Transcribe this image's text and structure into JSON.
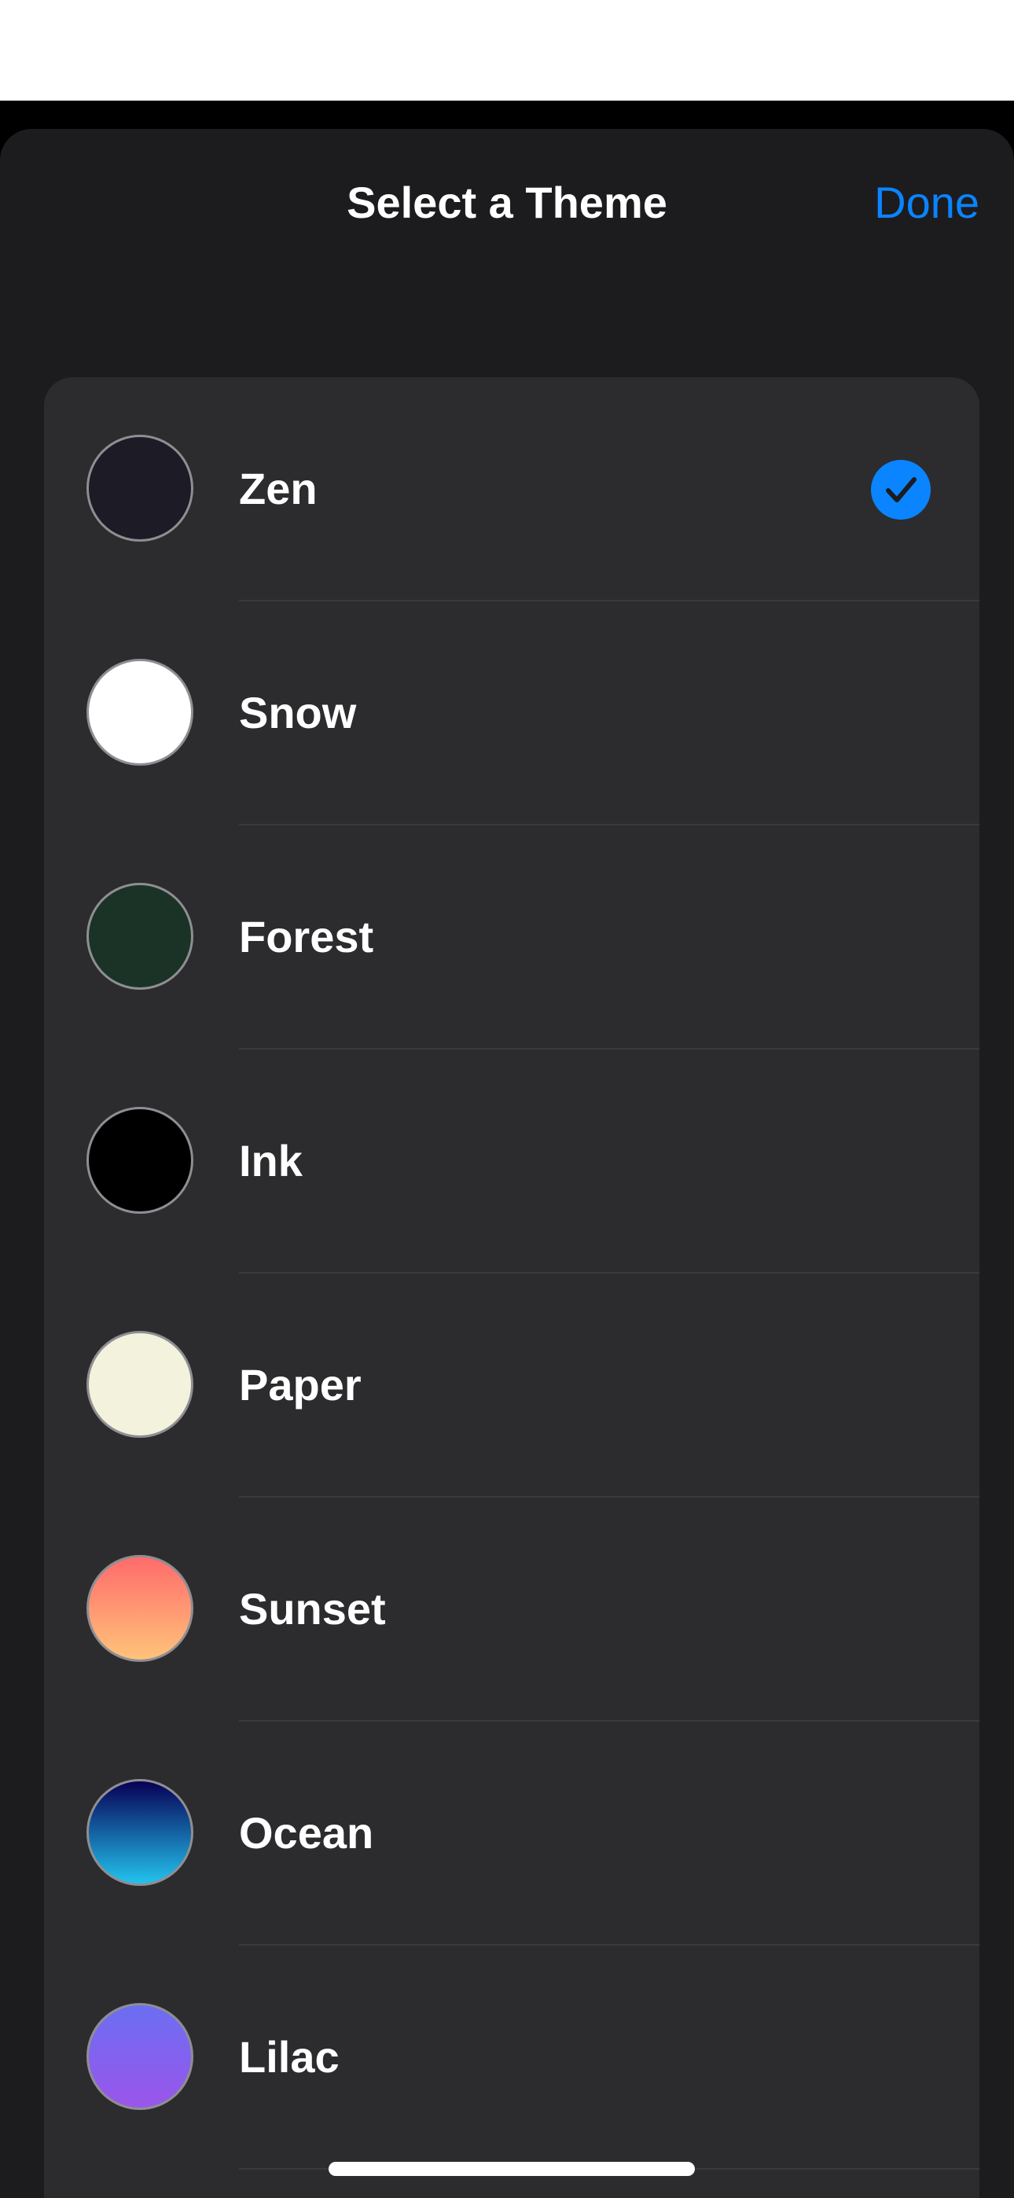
{
  "sheet": {
    "title": "Select a Theme",
    "done_label": "Done"
  },
  "themes": [
    {
      "label": "Zen",
      "swatch": "#1c1b26",
      "selected": true
    },
    {
      "label": "Snow",
      "swatch": "#ffffff",
      "selected": false
    },
    {
      "label": "Forest",
      "swatch": "#1a3326",
      "selected": false
    },
    {
      "label": "Ink",
      "swatch": "#000000",
      "selected": false
    },
    {
      "label": "Paper",
      "swatch": "#f3f2dc",
      "selected": false
    },
    {
      "label": "Sunset",
      "swatch_top": "#ff6b6b",
      "swatch_bottom": "#ffc37a",
      "selected": false
    },
    {
      "label": "Ocean",
      "swatch_top": "#070055",
      "swatch_bottom": "#22c3ee",
      "selected": false
    },
    {
      "label": "Lilac",
      "swatch_top": "#6b6ef2",
      "swatch_bottom": "#9b55ea",
      "selected": false
    }
  ],
  "colors": {
    "accent": "#0a84ff",
    "sheet_background": "#1c1c1e",
    "list_background": "#2c2c2e"
  },
  "icons": {
    "selected": "checkmark-circle-icon"
  }
}
